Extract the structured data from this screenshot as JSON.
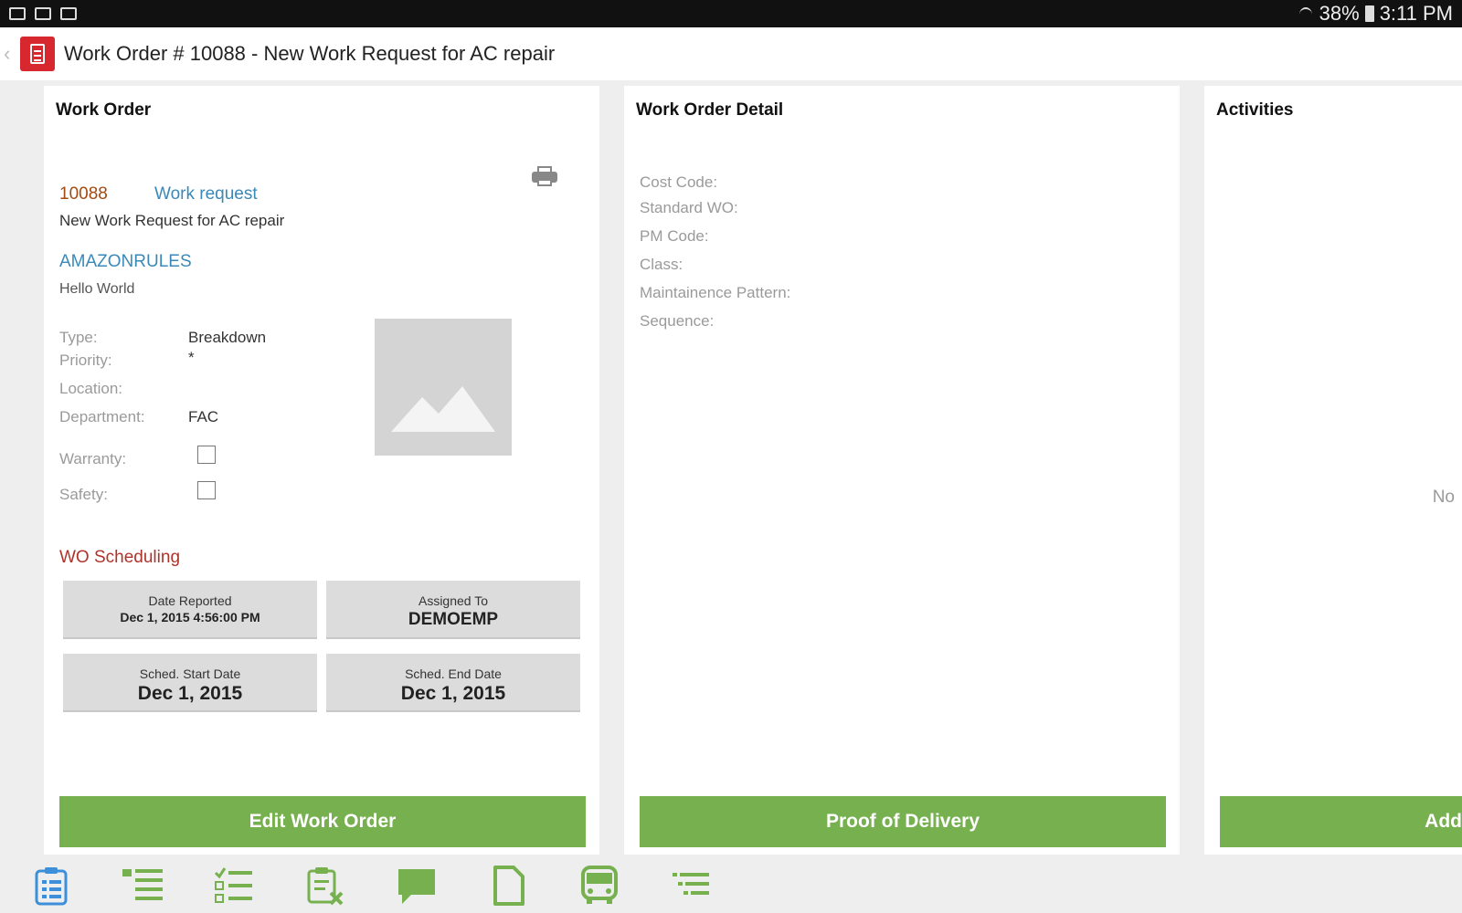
{
  "status_bar": {
    "battery": "38%",
    "time": "3:11 PM"
  },
  "title_bar": {
    "title": "Work Order # 10088 - New Work Request for AC repair"
  },
  "work_order": {
    "heading": "Work Order",
    "number": "10088",
    "request_type": "Work request",
    "description": "New Work Request for AC repair",
    "account": "AMAZONRULES",
    "account_subtitle": "Hello World",
    "fields": {
      "type_label": "Type:",
      "type_value": "Breakdown",
      "priority_label": "Priority:",
      "priority_value": "*",
      "location_label": "Location:",
      "location_value": "",
      "department_label": "Department:",
      "department_value": "FAC",
      "warranty_label": "Warranty:",
      "warranty_checked": false,
      "safety_label": "Safety:",
      "safety_checked": false
    },
    "scheduling": {
      "heading": "WO Scheduling",
      "date_reported_label": "Date Reported",
      "date_reported_value": "Dec 1, 2015 4:56:00 PM",
      "assigned_to_label": "Assigned To",
      "assigned_to_value": "DEMOEMP",
      "start_label": "Sched. Start Date",
      "start_value": "Dec 1, 2015",
      "end_label": "Sched. End Date",
      "end_value": "Dec 1, 2015"
    },
    "edit_button": "Edit Work Order"
  },
  "work_order_detail": {
    "heading": "Work Order Detail",
    "labels": [
      "Cost Code:",
      "Standard WO:",
      "PM Code:",
      "Class:",
      "Maintainence Pattern:",
      "Sequence:"
    ],
    "button": "Proof of Delivery"
  },
  "activities": {
    "heading": "Activities",
    "empty_text": "No",
    "button": "Add"
  },
  "toolbar": {
    "icons": [
      "work-order-icon",
      "list-icon",
      "checklist-icon",
      "clipboard-cancel-icon",
      "comment-icon",
      "document-icon",
      "vehicle-icon",
      "task-list-icon"
    ],
    "colors": {
      "active": "#3d8fd9",
      "inactive": "#76b04f"
    }
  }
}
